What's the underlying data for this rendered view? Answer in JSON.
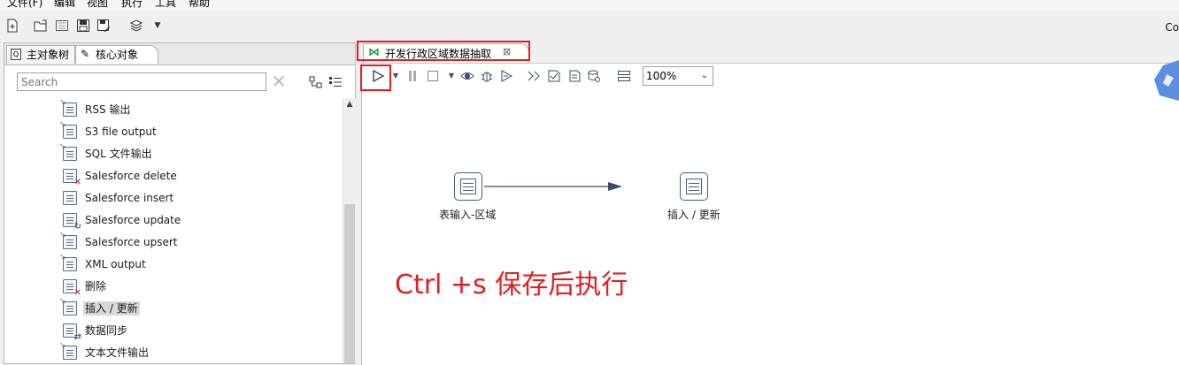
{
  "menu": [
    "文件(F)",
    "编辑",
    "视图",
    "执行",
    "工具",
    "帮助"
  ],
  "toolbar": {
    "icons": [
      "new-file-icon",
      "open-file-icon",
      "explore-repository-icon",
      "save-icon",
      "save-as-icon",
      "layers-icon",
      "dropdown-arrow-icon"
    ],
    "right_label": "Co"
  },
  "left_panel": {
    "tabs": [
      {
        "label": "主对象树",
        "icon": "main-tree-icon"
      },
      {
        "label": "核心对象",
        "icon": "pencil-icon"
      }
    ],
    "search": {
      "placeholder": "Search",
      "value": ""
    },
    "steps": [
      {
        "label": "RSS 输出"
      },
      {
        "label": "S3 file output"
      },
      {
        "label": "SQL 文件输出"
      },
      {
        "label": "Salesforce delete"
      },
      {
        "label": "Salesforce insert"
      },
      {
        "label": "Salesforce update"
      },
      {
        "label": "Salesforce upsert"
      },
      {
        "label": "XML output"
      },
      {
        "label": "删除"
      },
      {
        "label": "插入 / 更新",
        "selected": true
      },
      {
        "label": "数据同步"
      },
      {
        "label": "文本文件输出"
      }
    ]
  },
  "editor": {
    "tab_label": "开发行政区域数据抽取",
    "tab_close": "⊠",
    "zoom": "100%",
    "toolbar_icons": [
      "run-icon",
      "run-dropdown-icon",
      "pause-icon",
      "stop-icon",
      "stop-dropdown-icon",
      "preview-icon",
      "debug-icon",
      "replay-icon",
      "verify-icon",
      "impact-icon",
      "sql-icon",
      "explore-db-icon",
      "show-results-icon"
    ],
    "nodes": [
      {
        "label": "表输入-区域",
        "icon": "table-input-icon"
      },
      {
        "label": "插入 / 更新",
        "icon": "insert-update-icon"
      }
    ],
    "annotation": "Ctrl +s 保存后执行"
  },
  "colors": {
    "highlight": "#e02020",
    "annotation": "#e02020",
    "hop": "#3a4d66"
  }
}
